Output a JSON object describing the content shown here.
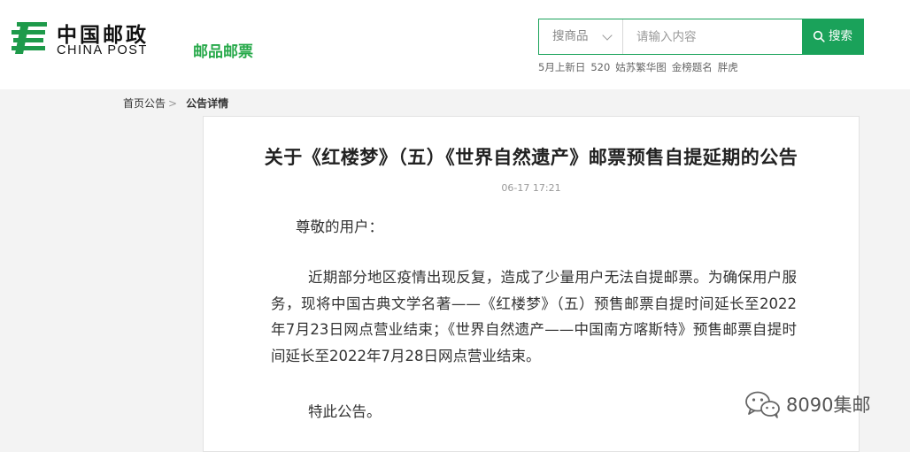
{
  "header": {
    "logo_cn": "中国邮政",
    "logo_en": "CHINA POST",
    "site_name": "邮品邮票",
    "brand_color": "#27a94a"
  },
  "search": {
    "category": "搜商品",
    "placeholder": "请输入内容",
    "button_label": "搜索",
    "accent": "#1aa25a",
    "hot_terms": [
      "5月上新日",
      "520",
      "姑苏繁华图",
      "金榜题名",
      "胖虎"
    ]
  },
  "breadcrumb": {
    "home": "首页公告",
    "separator": ">",
    "current": "公告详情"
  },
  "article": {
    "title": "关于《红楼梦》（五）《世界自然遗产》邮票预售自提延期的公告",
    "date": "06-17 17:21",
    "greeting": "尊敬的用户：",
    "body": "近期部分地区疫情出现反复，造成了少量用户无法自提邮票。为确保用户服务，现将中国古典文学名著——《红楼梦》（五）预售邮票自提时间延长至2022年7月23日网点营业结束；《世界自然遗产——中国南方喀斯特》预售邮票自提时间延长至2022年7月28日网点营业结束。",
    "closing": "特此公告。"
  },
  "watermark": {
    "icon": "wechat-icon",
    "text": "8090集邮"
  }
}
